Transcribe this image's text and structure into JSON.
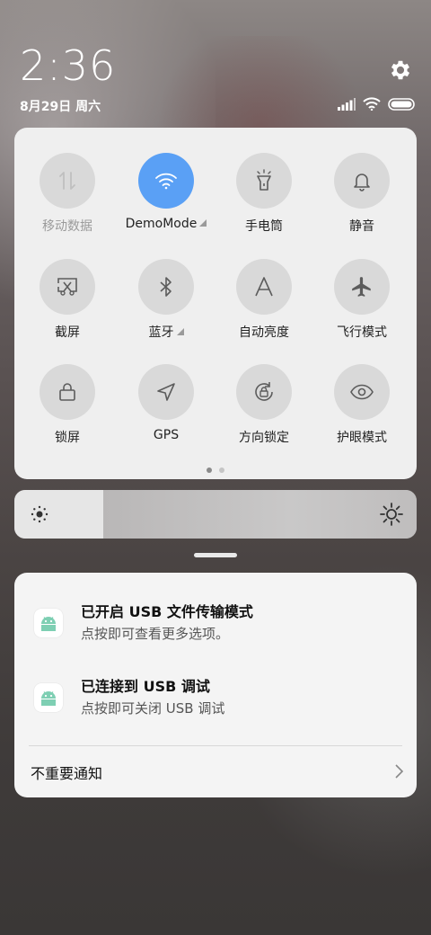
{
  "status": {
    "time": "2:36",
    "date": "8月29日 周六",
    "icons": [
      "settings-gear-icon",
      "signal-bars-icon",
      "wifi-icon",
      "battery-icon"
    ]
  },
  "quick_settings": {
    "tiles": [
      {
        "label": "移动数据",
        "icon": "mobile-data-icon",
        "state": "unavailable"
      },
      {
        "label": "DemoMode",
        "icon": "wifi-icon",
        "state": "on",
        "has_expand": true
      },
      {
        "label": "手电筒",
        "icon": "flashlight-icon",
        "state": "off"
      },
      {
        "label": "静音",
        "icon": "bell-icon",
        "state": "off"
      },
      {
        "label": "截屏",
        "icon": "screenshot-icon",
        "state": "off"
      },
      {
        "label": "蓝牙",
        "icon": "bluetooth-icon",
        "state": "off",
        "has_expand": true
      },
      {
        "label": "自动亮度",
        "icon": "auto-brightness-icon",
        "state": "off"
      },
      {
        "label": "飞行模式",
        "icon": "airplane-icon",
        "state": "off"
      },
      {
        "label": "锁屏",
        "icon": "lock-icon",
        "state": "off"
      },
      {
        "label": "GPS",
        "icon": "location-arrow-icon",
        "state": "off"
      },
      {
        "label": "方向锁定",
        "icon": "rotation-lock-icon",
        "state": "off"
      },
      {
        "label": "护眼模式",
        "icon": "eye-icon",
        "state": "off"
      }
    ],
    "page_indicator": {
      "pages": 2,
      "current": 1
    },
    "active_color": "#5aa0f5"
  },
  "brightness": {
    "level": 0.22
  },
  "notifications": [
    {
      "title": "已开启 USB 文件传输模式",
      "subtitle": "点按即可查看更多选项。",
      "icon": "android-icon"
    },
    {
      "title": "已连接到 USB 调试",
      "subtitle": "点按即可关闭 USB 调试",
      "icon": "android-icon"
    }
  ],
  "unimportant_label": "不重要通知"
}
